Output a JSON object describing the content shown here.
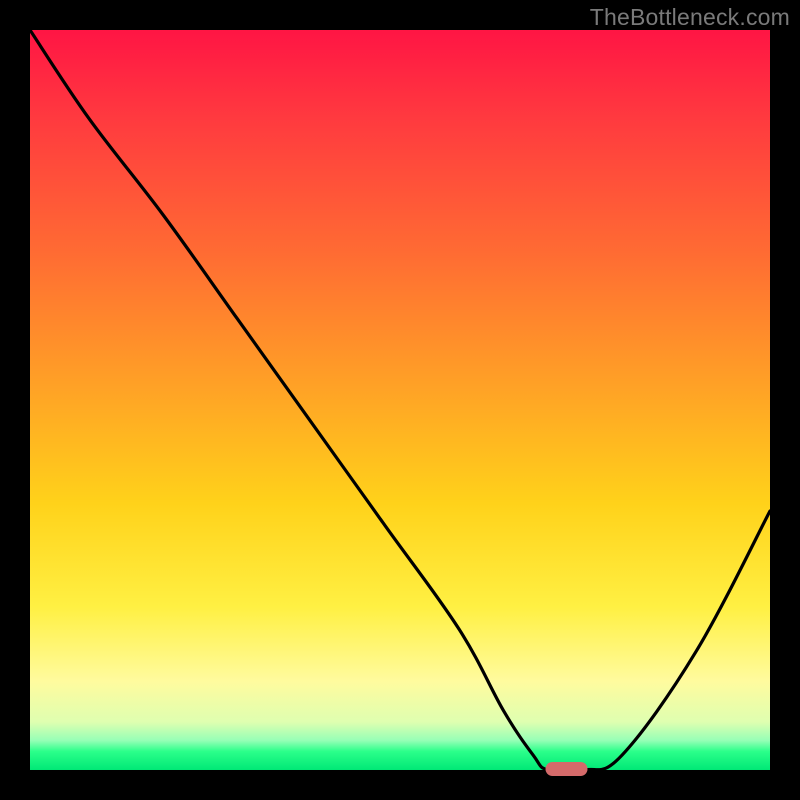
{
  "watermark": "TheBottleneck.com",
  "colors": {
    "frame": "#000000",
    "curve": "#000000",
    "pill": "#d46a6a",
    "gradient_top": "#ff1544",
    "gradient_bottom": "#00e876"
  },
  "chart_data": {
    "type": "line",
    "title": "",
    "xlabel": "",
    "ylabel": "",
    "xlim": [
      0,
      100
    ],
    "ylim": [
      0,
      100
    ],
    "grid": false,
    "x": [
      0,
      8,
      18,
      28,
      38,
      48,
      58,
      64,
      68,
      70,
      75,
      80,
      90,
      100
    ],
    "values": [
      100,
      88,
      75,
      61,
      47,
      33,
      19,
      8,
      2,
      0,
      0,
      2,
      16,
      35
    ],
    "marker": {
      "x": 72.5,
      "y": 0,
      "shape": "pill"
    },
    "note": "Curve descends from top-left, slight inflection ~18%, reaches floor ~70-75% x, then rises toward right edge."
  }
}
